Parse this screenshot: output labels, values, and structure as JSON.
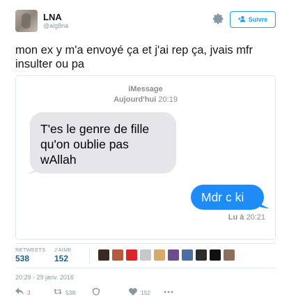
{
  "header": {
    "display_name": "LNA",
    "handle": "@alg8na",
    "follow_label": "Suivre"
  },
  "tweet": {
    "text": "mon ex y m'a envoyé ça et j'ai rep ça, jvais mfr insulter ou pa"
  },
  "media": {
    "title": "iMessage",
    "date_day": "Aujourd'hui",
    "date_time": "20:19",
    "incoming_message": "T'es le genre de fille qu'on oublie pas wAllah",
    "outgoing_message": "Mdr c ki",
    "read_label": "Lu à",
    "read_time": "20:21",
    "incoming_bubble_color": "#e5e5ea",
    "outgoing_bubble_color": "#1f8bf6"
  },
  "stats": {
    "retweets_label": "RETWEETS",
    "retweets_count": "538",
    "likes_label": "J'AIME",
    "likes_count": "152",
    "liker_avatar_colors": [
      "#3b2a22",
      "#b85a3c",
      "#d8262b",
      "#c8c8c8",
      "#d9a86b",
      "#6a4d8e",
      "#4b6fa0",
      "#2d2d2d",
      "#111111",
      "#8a6f5a"
    ]
  },
  "timestamp": "20:29 - 29 janv. 2016",
  "actions": {
    "reply_count": "3",
    "retweet_count": "538",
    "like_count": "152"
  },
  "icons": {
    "gear": "gear-icon",
    "follow": "person-add-icon",
    "reply": "reply-icon",
    "retweet": "retweet-icon",
    "direct_message": "shield-icon",
    "like": "heart-icon",
    "more": "more-icon"
  },
  "colors": {
    "accent": "#1da1f2",
    "muted": "#8899a6",
    "stat_value": "#1b5f8f"
  }
}
